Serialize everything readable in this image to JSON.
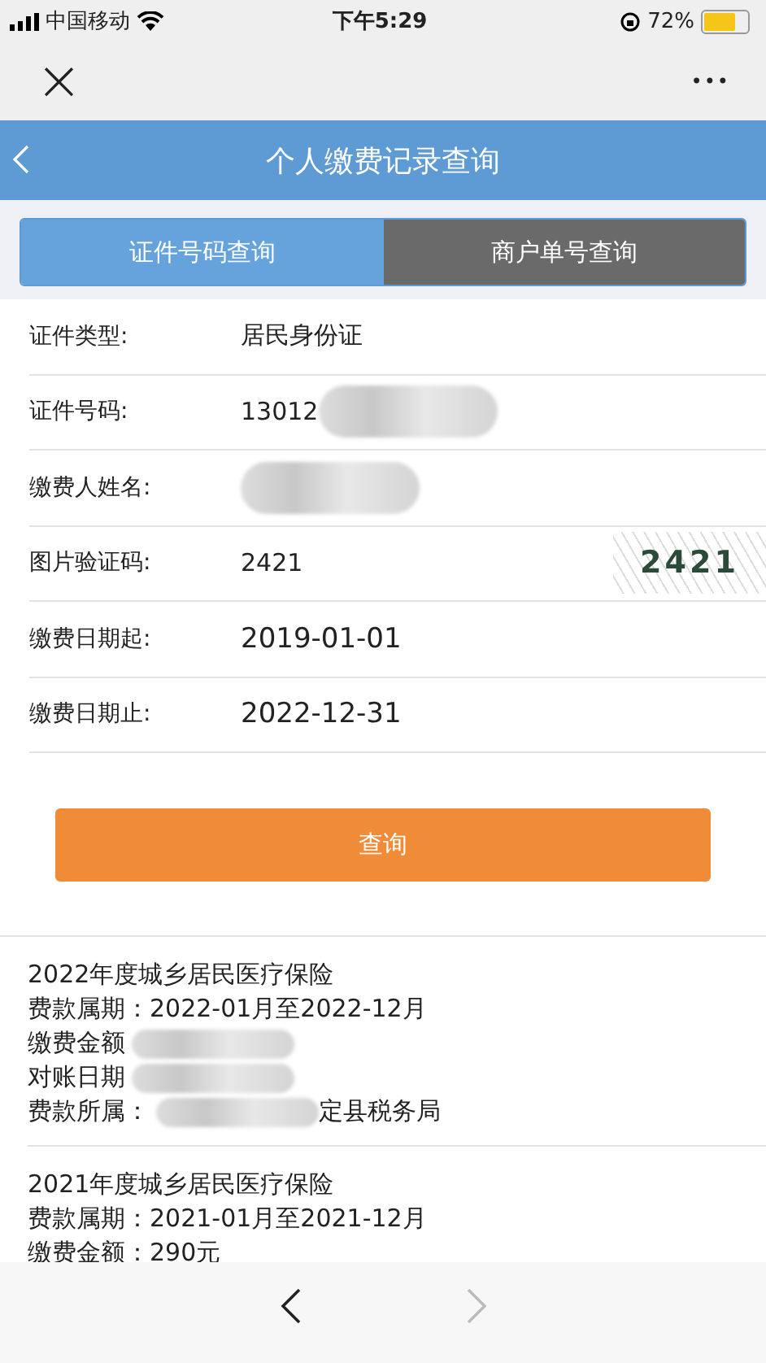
{
  "status_bar": {
    "carrier": "中国移动",
    "time": "下午5:29",
    "battery": "72%"
  },
  "nav": {
    "close": "×",
    "more": "•••"
  },
  "header": {
    "title": "个人缴费记录查询"
  },
  "tabs": [
    {
      "label": "证件号码查询",
      "selected": true
    },
    {
      "label": "商户单号查询",
      "selected": false
    }
  ],
  "form": [
    {
      "label": "证件类型:",
      "value": "居民身份证",
      "redacted": false,
      "kind": "text"
    },
    {
      "label": "证件号码:",
      "value": "13012",
      "redacted": true,
      "kind": "text"
    },
    {
      "label": "缴费人姓名:",
      "redacted": true,
      "kind": "text"
    },
    {
      "label": "图片验证码:",
      "value": "2421",
      "redacted": false,
      "kind": "captcha",
      "captcha": "2421"
    },
    {
      "label": "缴费日期起:",
      "value": "2019-01-01",
      "redacted": false,
      "kind": "date"
    },
    {
      "label": "缴费日期止:",
      "value": "2022-12-31",
      "redacted": false,
      "kind": "date"
    }
  ],
  "submit": "查询",
  "records": [
    {
      "title": "2022年度城乡居民医疗保险",
      "lines": [
        {
          "text": "费款属期：2022-01月至2022-12月",
          "redacted": false
        },
        {
          "text": "缴费金额",
          "redacted": true
        },
        {
          "text": "对账日期",
          "redacted": true
        },
        {
          "text": "费款所属：",
          "tail": "定县税务局",
          "redacted": true
        }
      ]
    },
    {
      "title": "2021年度城乡居民医疗保险",
      "lines": [
        {
          "text": "费款属期：2021-01月至2021-12月",
          "redacted": false
        },
        {
          "text": "缴费金额：290元",
          "redacted": false
        }
      ]
    }
  ],
  "toolbar": {
    "back_enabled": true,
    "forward_enabled": false
  }
}
